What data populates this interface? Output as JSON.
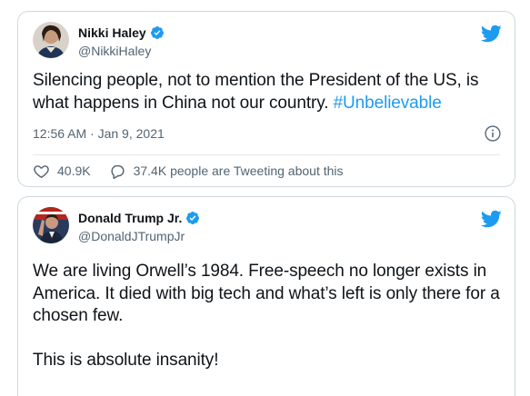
{
  "tweets": [
    {
      "display_name": "Nikki Haley",
      "handle": "@NikkiHaley",
      "text_before": "Silencing people, not to mention the President of the US, is what happens in China not our country. ",
      "hashtag": "#Unbelievable",
      "timestamp": "12:56 AM · Jan 9, 2021",
      "likes": "40.9K",
      "conversation": "37.4K people are Tweeting about this"
    },
    {
      "display_name": "Donald Trump Jr.",
      "handle": "@DonaldJTrumpJr",
      "text": "We are living Orwell’s 1984. Free-speech no longer exists in America. It died with big tech and what’s left is only there for a chosen few.\n\nThis is absolute insanity!"
    }
  ],
  "icons": {
    "brand": "twitter-bird-icon",
    "verified": "verified-badge-icon",
    "info": "info-icon",
    "like": "heart-icon",
    "reply": "speech-bubble-icon"
  },
  "colors": {
    "accent": "#1d9bf0",
    "text": "#0f1419",
    "secondary": "#536471",
    "border": "#cfd9de"
  }
}
